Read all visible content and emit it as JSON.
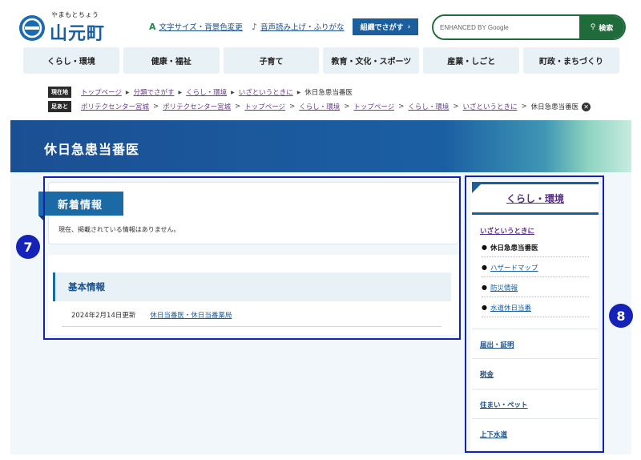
{
  "header": {
    "logo_kana": "やまもとちょう",
    "logo_name": "山元町",
    "text_size_label": "文字サイズ・背景色変更",
    "voice_label": "音声読み上げ・ふりがな",
    "org_search_label": "組織でさがす",
    "search": {
      "placeholder": "ENHANCED BY Google",
      "button_label": "検索"
    }
  },
  "gnav": [
    "くらし・環境",
    "健康・福祉",
    "子育て",
    "教育・文化・スポーツ",
    "産業・しごと",
    "町政・まちづくり"
  ],
  "breadcrumb_current": {
    "tag": "現在地",
    "links": [
      "トップページ",
      "分類でさがす",
      "くらし・環境",
      "いざというときに"
    ],
    "current": "休日急患当番医"
  },
  "breadcrumb_history": {
    "tag": "足あと",
    "links": [
      "ポリテクセンター宮城",
      "ポリテクセンター宮城",
      "トップページ",
      "くらし・環境",
      "トップページ",
      "くらし・環境",
      "いざというときに"
    ],
    "current": "休日急患当番医"
  },
  "page_title": "休日急患当番医",
  "news": {
    "title": "新着情報",
    "empty_text": "現在、掲載されている情報はありません。"
  },
  "basic_info": {
    "title": "基本情報",
    "updated": "2024年2月14日更新",
    "link": "休日当番医・休日当番薬局"
  },
  "badges": {
    "main": "7",
    "side": "8"
  },
  "side": {
    "title": "くらし・環境",
    "subtitle": "いざというときに",
    "items": [
      {
        "label": "休日急患当番医",
        "current": true
      },
      {
        "label": "ハザードマップ",
        "current": false
      },
      {
        "label": "防災情報",
        "current": false
      },
      {
        "label": "水道休日当番",
        "current": false
      }
    ],
    "categories": [
      "届出・証明",
      "税金",
      "住まい・ペット",
      "上下水道"
    ]
  },
  "colors": {
    "brand_blue": "#1b5e9e",
    "search_green": "#1f6b3a",
    "frame": "#1422b7"
  }
}
